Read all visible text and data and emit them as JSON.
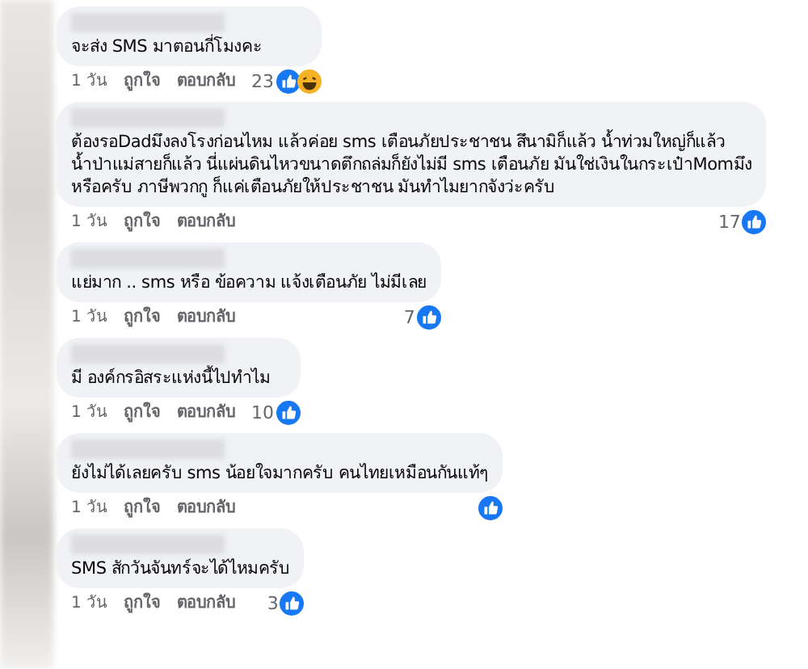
{
  "comments": [
    {
      "text": "จะส่ง SMS มาตอนกี่โมงคะ",
      "time": "1 วัน",
      "like_label": "ถูกใจ",
      "reply_label": "ตอบกลับ",
      "reaction_count": "23",
      "reactions": [
        {
          "kind": "like"
        },
        {
          "kind": "haha"
        }
      ]
    },
    {
      "text": "ต้องรอDadมึงลงโรงก่อนไหม แล้วค่อย sms เตือนภัยประชาชน สึนามิก็แล้ว น้ำท่วมใหญ่ก็แล้ว\nน้ำป่าแม่สายก็แล้ว นี่แผ่นดินไหวขนาดตึกถล่มก็ยังไม่มี sms เตือนภัย มันใช่เงินในกระเป๋าMomมึง\nหรือครับ ภาษีพวกกู ก็แค่เตือนภัยให้ประชาชน มันทำไมยากจังว่ะครับ",
      "time": "1 วัน",
      "like_label": "ถูกใจ",
      "reply_label": "ตอบกลับ",
      "reaction_count": "17",
      "reactions": [
        {
          "kind": "like"
        }
      ]
    },
    {
      "text": "แย่มาก .. sms หรือ ข้อความ แจ้งเตือนภัย ไม่มีเลย",
      "time": "1 วัน",
      "like_label": "ถูกใจ",
      "reply_label": "ตอบกลับ",
      "reaction_count": "7",
      "reactions": [
        {
          "kind": "like"
        }
      ]
    },
    {
      "text": "มี องค์กรอิสระแห่งนี้ไปทำไม",
      "time": "1 วัน",
      "like_label": "ถูกใจ",
      "reply_label": "ตอบกลับ",
      "reaction_count": "10",
      "reactions": [
        {
          "kind": "like"
        }
      ]
    },
    {
      "text": "ยังไม่ได้เลยครับ sms น้อยใจมากครับ คนไทยเหมือนกันแท้ๆ",
      "time": "1 วัน",
      "like_label": "ถูกใจ",
      "reply_label": "ตอบกลับ",
      "reactions": [
        {
          "kind": "like"
        }
      ]
    },
    {
      "text": "SMS สักวันจันทร์จะได้ไหมครับ",
      "time": "1 วัน",
      "like_label": "ถูกใจ",
      "reply_label": "ตอบกลับ",
      "reaction_count": "3",
      "reactions": [
        {
          "kind": "like"
        }
      ]
    }
  ]
}
